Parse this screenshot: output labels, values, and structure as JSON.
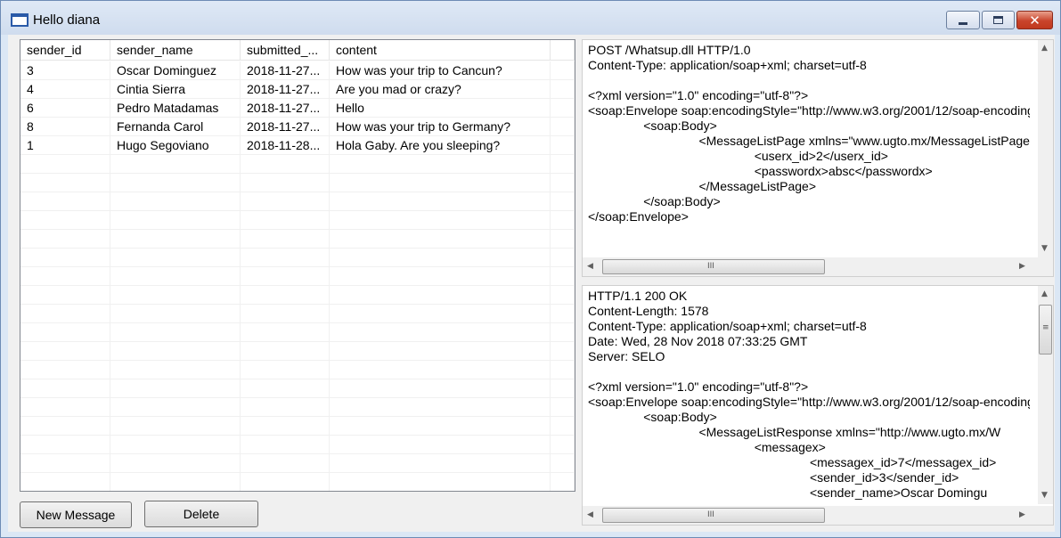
{
  "window": {
    "title": "Hello diana",
    "min_glyph": "",
    "max_glyph": "",
    "close_glyph": "✕"
  },
  "grid": {
    "columns": [
      "sender_id",
      "sender_name",
      "submitted_...",
      "content",
      ""
    ],
    "rows": [
      [
        "3",
        "Oscar Dominguez",
        "2018-11-27...",
        "How was your trip to Cancun?"
      ],
      [
        "4",
        "Cintia Sierra",
        "2018-11-27...",
        "Are you mad or crazy?"
      ],
      [
        "6",
        "Pedro Matadamas",
        "2018-11-27...",
        "Hello"
      ],
      [
        "8",
        "Fernanda Carol",
        "2018-11-27...",
        "How was your trip to Germany?"
      ],
      [
        "1",
        "Hugo Segoviano",
        "2018-11-28...",
        "Hola Gaby.  Are you sleeping?"
      ]
    ]
  },
  "buttons": {
    "new_message": "New Message",
    "delete": "Delete"
  },
  "request_text": "POST /Whatsup.dll HTTP/1.0\nContent-Type: application/soap+xml; charset=utf-8\n\n<?xml version=\"1.0\" encoding=\"utf-8\"?>\n<soap:Envelope soap:encodingStyle=\"http://www.w3.org/2001/12/soap-encoding\">\n\t\t<soap:Body>\n\t\t\t\t<MessageListPage xmlns=\"www.ugto.mx/MessageListPage\">\n\t\t\t\t\t\t<userx_id>2</userx_id>\n\t\t\t\t\t\t<passwordx>absc</passwordx>\n\t\t\t\t</MessageListPage>\n\t\t</soap:Body>\n</soap:Envelope>",
  "response_text": "HTTP/1.1 200 OK\nContent-Length: 1578\nContent-Type: application/soap+xml; charset=utf-8\nDate: Wed, 28 Nov 2018 07:33:25 GMT\nServer: SELO\n\n<?xml version=\"1.0\" encoding=\"utf-8\"?>\n<soap:Envelope soap:encodingStyle=\"http://www.w3.org/2001/12/soap-encoding\">\n\t\t<soap:Body>\n\t\t\t\t<MessageListResponse xmlns=\"http://www.ugto.mx/W\n\t\t\t\t\t\t<messagex>\n\t\t\t\t\t\t\t\t<messagex_id>7</messagex_id>\n\t\t\t\t\t\t\t\t<sender_id>3</sender_id>\n\t\t\t\t\t\t\t\t<sender_name>Oscar Domingu",
  "scroll": {
    "up": "▲",
    "down": "▼",
    "left": "◀",
    "right": "▶",
    "grip_h": "III",
    "grip_v": "≡"
  }
}
